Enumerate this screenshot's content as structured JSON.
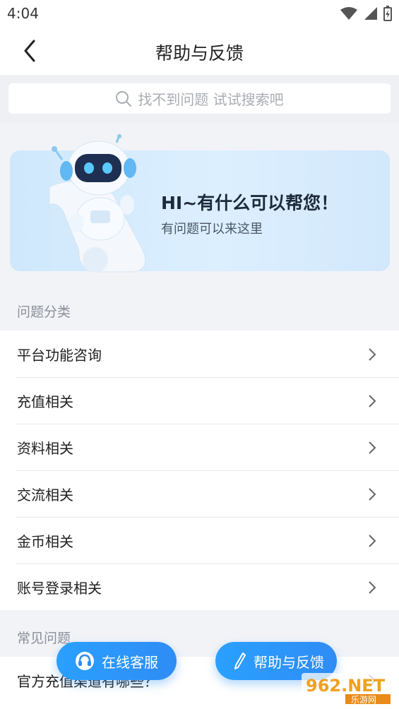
{
  "status_bar": {
    "time": "4:04"
  },
  "header": {
    "title": "帮助与反馈"
  },
  "search": {
    "placeholder": "找不到问题 试试搜索吧"
  },
  "banner": {
    "title": "HI~有什么可以帮您！",
    "subtitle": "有问题可以来这里"
  },
  "categories": {
    "label": "问题分类",
    "items": [
      "平台功能咨询",
      "充值相关",
      "资料相关",
      "交流相关",
      "金币相关",
      "账号登录相关"
    ]
  },
  "faq": {
    "label": "常见问题",
    "items": [
      "官方充值渠道有哪些？"
    ]
  },
  "fab": {
    "online_service": "在线客服",
    "feedback": "帮助与反馈"
  },
  "watermark": {
    "brand": "962.NET",
    "sub": "乐游网"
  },
  "colors": {
    "accent": "#2f8cf5",
    "banner": "#d6ebfc"
  }
}
